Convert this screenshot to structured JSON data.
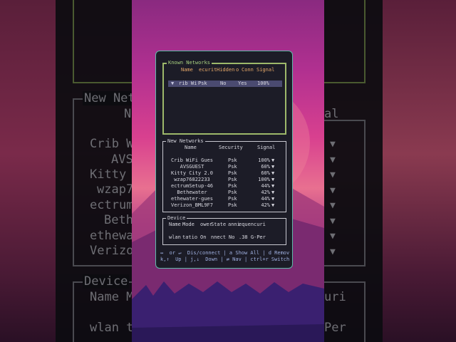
{
  "known_networks": {
    "title": "Known Networks",
    "headers": [
      "Name",
      "ecurit",
      "Hidden",
      "o",
      "Conn",
      "Signal"
    ],
    "rows": [
      {
        "marker": "▼",
        "name": "rib Wi",
        "security": "Psk",
        "hidden": "No",
        "conn": "Yes",
        "signal": "100%"
      }
    ]
  },
  "new_networks": {
    "title": "New Networks",
    "headers": [
      "Name",
      "Security",
      "Signal"
    ],
    "rows": [
      {
        "name": "Crib WiFi Gues",
        "security": "Psk",
        "signal": "100%"
      },
      {
        "name": "AVSGUEST",
        "security": "Psk",
        "signal": "60%"
      },
      {
        "name": "Kitty City 2.0",
        "security": "Psk",
        "signal": "60%"
      },
      {
        "name": "wzap76822233",
        "security": "Psk",
        "signal": "100%"
      },
      {
        "name": "ectrumSetup-46",
        "security": "Psk",
        "signal": "44%"
      },
      {
        "name": "Bethewater",
        "security": "Psk",
        "signal": "42%"
      },
      {
        "name": "ethewater-gues",
        "security": "Psk",
        "signal": "44%"
      },
      {
        "name": "Verizon_BML9F7",
        "security": "Psk",
        "signal": "42%"
      }
    ]
  },
  "device": {
    "title": "Device",
    "headers": [
      "Name",
      "Mode",
      "ower",
      "State",
      "anni",
      "equen",
      "curi"
    ],
    "values": [
      "wlan",
      "tatio",
      "On",
      "nnect",
      "No",
      ".38 G",
      "-Per"
    ]
  },
  "help": {
    "line1": "↔  or ↵  Dis/connect | a Show All | d Remov",
    "line2": "k,↑  Up | j,↓  Down | ⇄ Nav | ctrl+r Switch"
  },
  "bg_left": {
    "title": "New Net",
    "header": "N",
    "rows": [
      "Crib W",
      "AVS",
      "Kitty",
      "wzap7",
      "ectrum",
      "Beth",
      "ethewa",
      "Verizo"
    ],
    "device": "Device",
    "dev_hdr": "Name M",
    "dev_val": "wlan t"
  },
  "bg_right": {
    "header": "al",
    "dev_hdr": "uri",
    "dev_val": "Per"
  },
  "wifi_icon": "▼"
}
